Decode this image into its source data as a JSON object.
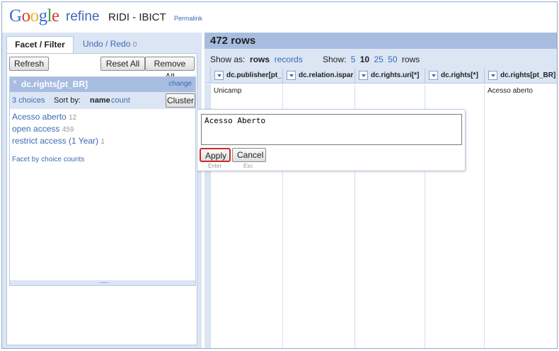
{
  "header": {
    "logo_google": "Google",
    "logo_refine": "refine",
    "project_name": "RIDI - IBICT",
    "permalink": "Permalink"
  },
  "left": {
    "tabs": [
      {
        "label": "Facet / Filter"
      },
      {
        "label": "Undo / Redo",
        "count": "0"
      }
    ],
    "buttons": {
      "refresh": "Refresh",
      "reset_all": "Reset All",
      "remove_all": "Remove All"
    },
    "facet": {
      "close_glyph": "×",
      "name": "dc.rights[pt_BR]",
      "change": "change",
      "choices_count": "3 choices",
      "sort_by": "Sort by:",
      "sort_name": "name",
      "sort_count": "count",
      "cluster": "Cluster",
      "choices": [
        {
          "label": "Acesso aberto",
          "count": "12"
        },
        {
          "label": "open access",
          "count": "459"
        },
        {
          "label": "restrict access (1 Year)",
          "count": "1"
        }
      ],
      "facet_by_counts": "Facet by choice counts"
    }
  },
  "right": {
    "rows": "472 rows",
    "show_as_label": "Show as:",
    "show_as_rows": "rows",
    "show_as_records": "records",
    "show_label": "Show:",
    "show_options": [
      "5",
      "10",
      "25",
      "50"
    ],
    "show_selected": "10",
    "show_suffix": "rows",
    "columns": [
      {
        "label": "dc.publisher[pt_"
      },
      {
        "label": "dc.relation.ispar"
      },
      {
        "label": "dc.rights.uri[*]"
      },
      {
        "label": "dc.rights[*]"
      },
      {
        "label": "dc.rights[pt_BR]"
      }
    ],
    "row1": {
      "publisher": "Unicamp",
      "rights_pt_br": "Acesso aberto"
    }
  },
  "editor": {
    "value": "Acesso Aberto",
    "apply": "Apply",
    "cancel": "Cancel",
    "apply_hint": "Enter",
    "cancel_hint": "Esc"
  },
  "colors": {
    "panel_blue": "#dbe5f4",
    "bar_blue": "#a7bde0",
    "link_blue": "#3a6bb5",
    "highlight_red": "#d0282a"
  }
}
